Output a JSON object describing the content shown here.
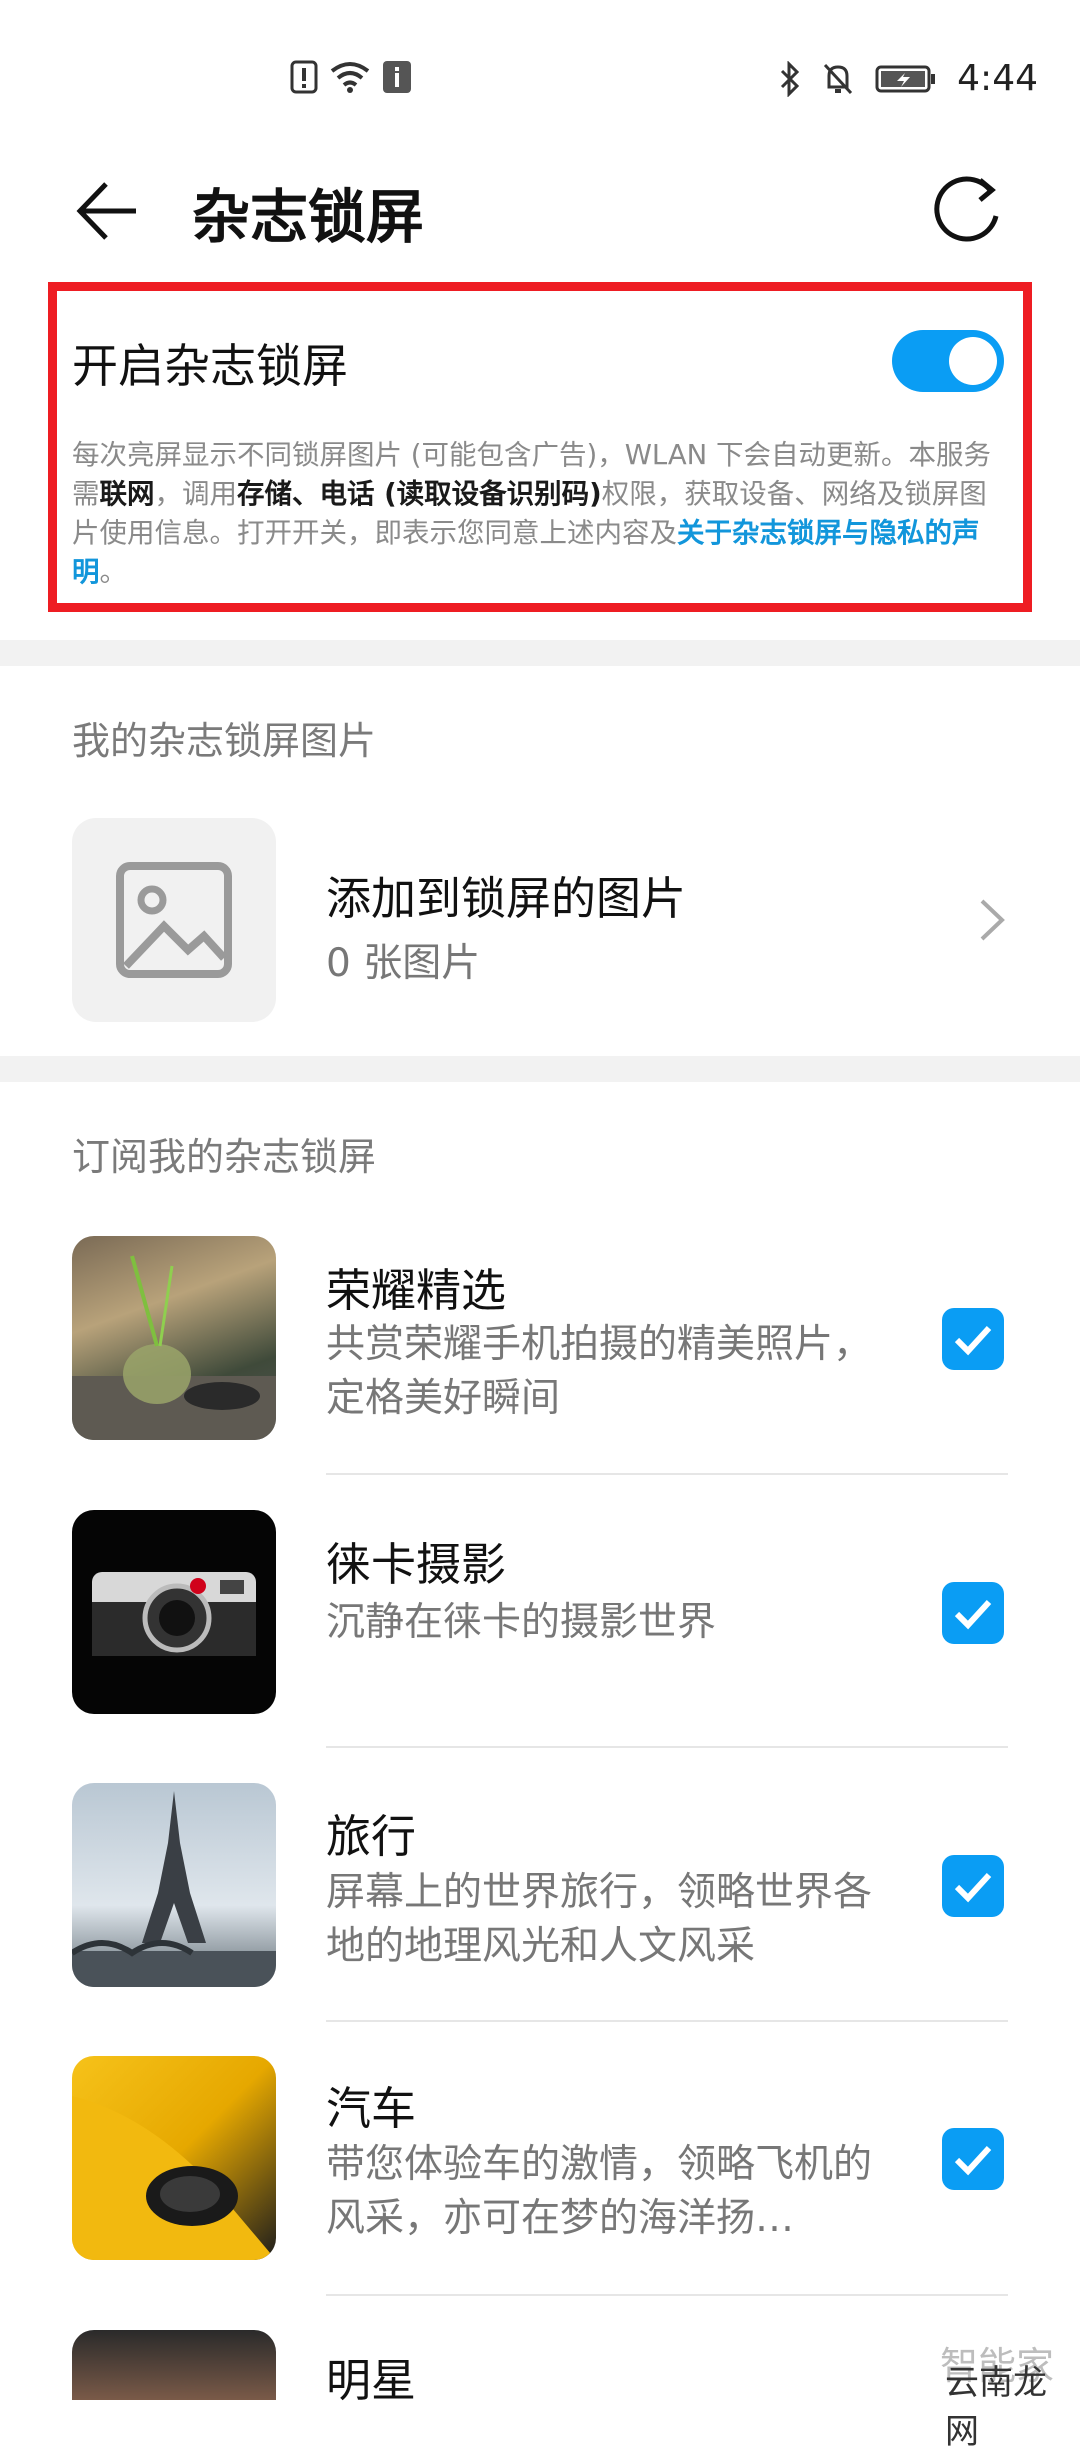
{
  "status_bar": {
    "time": "4:44",
    "icons": [
      "alert-icon",
      "wifi-icon",
      "info-icon",
      "bluetooth-icon",
      "mute-bell-icon",
      "battery-charging-icon"
    ]
  },
  "header": {
    "title": "杂志锁屏",
    "back_icon": "back-arrow-icon",
    "refresh_icon": "refresh-icon"
  },
  "main_toggle": {
    "label": "开启杂志锁屏",
    "enabled": true,
    "description": {
      "part1": "每次亮屏显示不同锁屏图片 (可能包含广告)，WLAN 下会自动更新。本服务需",
      "bold1": "联网",
      "part2": "，调用",
      "bold2": "存储、电话 (读取设备识别码)",
      "part3": "权限，获取设备、网络及锁屏图片使用信息。打开开关，即表示您同意上述内容及",
      "link": "关于杂志锁屏与隐私的声明",
      "part4": "。"
    }
  },
  "my_pictures": {
    "section_title": "我的杂志锁屏图片",
    "item_title": "添加到锁屏的图片",
    "item_subtitle": "0 张图片"
  },
  "subscriptions": {
    "section_title": "订阅我的杂志锁屏",
    "items": [
      {
        "title": "荣耀精选",
        "desc": "共赏荣耀手机拍摄的精美照片，定格美好瞬间",
        "checked": true
      },
      {
        "title": "徕卡摄影",
        "desc": "沉静在徕卡的摄影世界",
        "checked": true
      },
      {
        "title": "旅行",
        "desc": "屏幕上的世界旅行，领略世界各地的地理风光和人文风采",
        "checked": true
      },
      {
        "title": "汽车",
        "desc": "带您体验车的激情，领略飞机的风采，亦可在梦的海洋扬…",
        "checked": true
      },
      {
        "title": "明星",
        "desc": "",
        "checked": true
      }
    ]
  },
  "watermark": {
    "line1": "智能家",
    "line2": "云南龙网"
  },
  "colors": {
    "accent": "#0a9df4",
    "highlight_border": "#ee1d23",
    "link": "#1296db"
  }
}
